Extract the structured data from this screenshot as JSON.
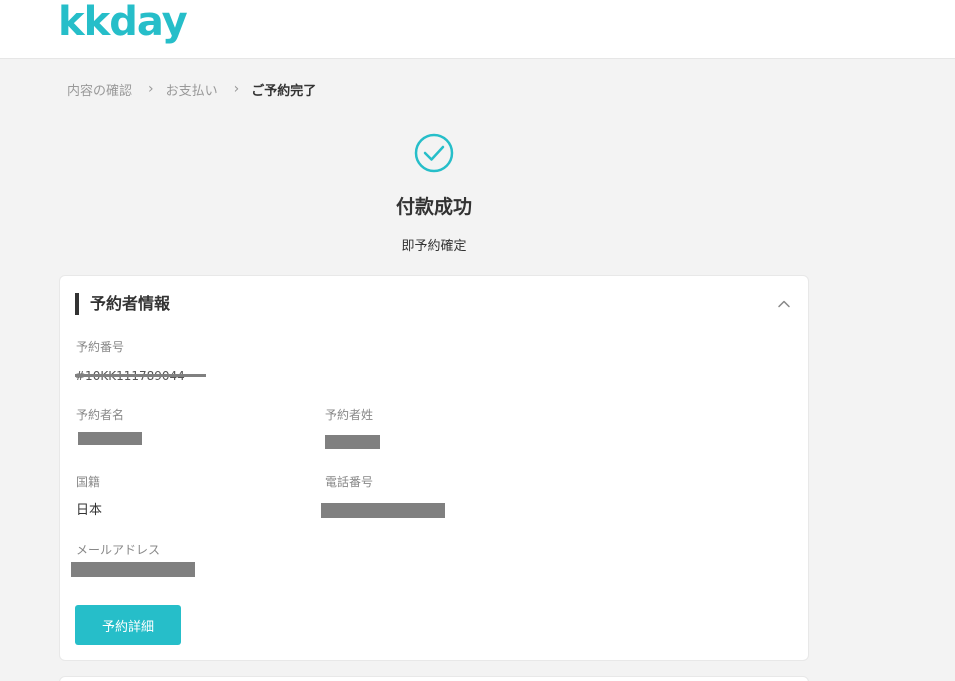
{
  "header": {
    "logo_text": "kkday"
  },
  "breadcrumb": {
    "items": [
      "内容の確認",
      "お支払い",
      "ご予約完了"
    ],
    "separator": "›"
  },
  "success": {
    "title": "付款成功",
    "subtitle": "即予約確定",
    "accent_color": "#26bec9"
  },
  "booker_card": {
    "title": "予約者情報",
    "booking_number_label": "予約番号",
    "booking_number_value": "#10KK111789044",
    "first_name_label": "予約者名",
    "last_name_label": "予約者姓",
    "nationality_label": "国籍",
    "nationality_value": "日本",
    "phone_label": "電話番号",
    "email_label": "メールアドレス",
    "detail_button_label": "予約詳細"
  }
}
